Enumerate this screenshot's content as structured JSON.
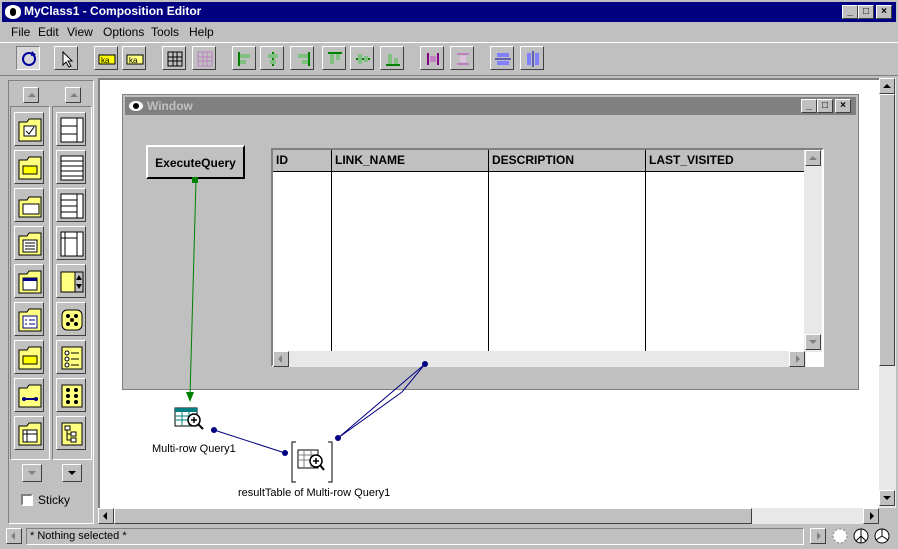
{
  "window": {
    "title": "MyClass1 - Composition Editor"
  },
  "menu": [
    "File",
    "Edit",
    "View",
    "Options",
    "Tools",
    "Help"
  ],
  "palette": {
    "sticky_label": "Sticky"
  },
  "inner_window": {
    "title": "Window"
  },
  "execute_button": {
    "label": "ExecuteQuery"
  },
  "table": {
    "columns": [
      "ID",
      "LINK_NAME",
      "DESCRIPTION",
      "LAST_VISITED"
    ]
  },
  "parts": {
    "multi_row_query": "Multi-row Query1",
    "result_table": "resultTable of Multi-row Query1"
  },
  "status": {
    "text": "* Nothing selected *"
  },
  "colors": {
    "title_active": "#000080",
    "title_inactive": "#808080",
    "connection_green": "#008000",
    "connection_blue": "#000080"
  }
}
